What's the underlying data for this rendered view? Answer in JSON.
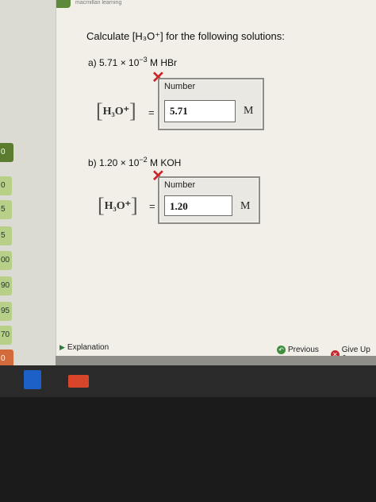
{
  "rail": {
    "items": [
      "0",
      "0",
      "5",
      "5",
      "00",
      "90",
      "95",
      "70",
      "0"
    ]
  },
  "header": {
    "brand": "macmillan learning"
  },
  "question": {
    "title": "Calculate [H₃O⁺] for the following solutions:",
    "part_a": {
      "label": "a) 5.71 × 10",
      "exponent": "−3",
      "suffix": " M HBr",
      "number_label": "Number",
      "value": "5.71",
      "unit": "M"
    },
    "part_b": {
      "label": "b) 1.20 × 10",
      "exponent": "−2",
      "suffix": " M KOH",
      "number_label": "Number",
      "value": "1.20",
      "unit": "M"
    },
    "h3o_label": "H₃O⁺",
    "equals": "="
  },
  "footer": {
    "explanation": "Explanation",
    "previous": "Previous",
    "give_up": "Give Up &"
  },
  "colors": {
    "accent_green": "#5b7c2f",
    "error_red": "#c8262b",
    "panel_bg": "#f1efe8"
  },
  "icons": {
    "wrong_mark": "cross-icon",
    "explanation": "triangle-right-icon",
    "previous": "back-arrow-icon",
    "give_up": "x-circle-icon"
  }
}
